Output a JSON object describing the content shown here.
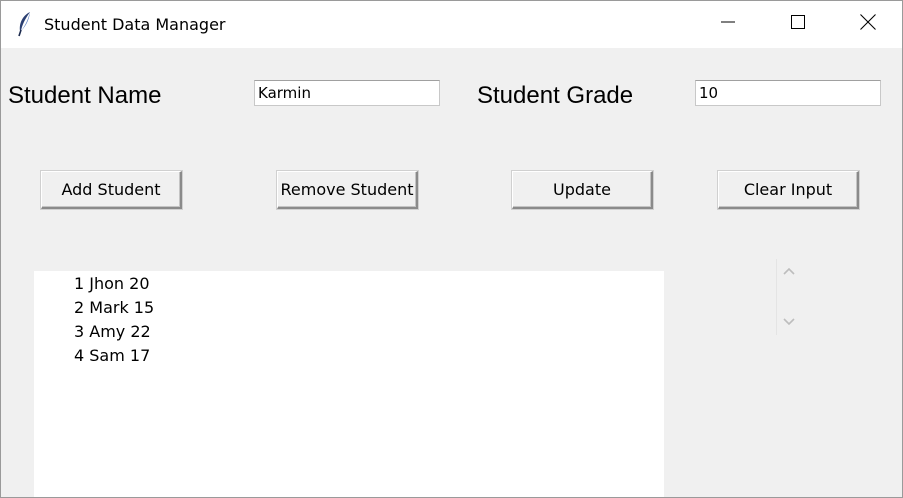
{
  "window": {
    "title": "Student Data Manager",
    "icon": "feather-icon",
    "controls": [
      "minimize-icon",
      "maximize-icon",
      "close-icon"
    ]
  },
  "form": {
    "name_label": "Student Name",
    "name_value": "Karmin",
    "grade_label": "Student Grade",
    "grade_value": "10"
  },
  "buttons": {
    "add": "Add Student",
    "remove": "Remove Student",
    "update": "Update",
    "clear": "Clear Input"
  },
  "students": [
    "1 Jhon 20",
    "2 Mark 15",
    "3 Amy 22",
    "4 Sam 17"
  ],
  "scrollbar": {
    "up_icon": "chevron-up-icon",
    "down_icon": "chevron-down-icon"
  }
}
